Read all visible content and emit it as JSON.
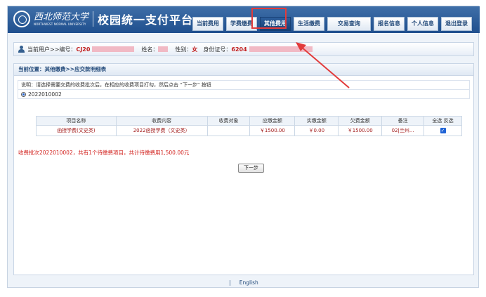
{
  "header": {
    "univ_cn": "西北师范大学",
    "univ_en": "NORTHWEST NORMAL UNIVERSITY",
    "platform_title": "校园统一支付平台"
  },
  "nav": [
    {
      "label": "当前费用",
      "active": false
    },
    {
      "label": "学费缴费",
      "active": false
    },
    {
      "label": "其他费用",
      "active": true
    },
    {
      "label": "生活缴费",
      "active": false
    },
    {
      "label": "交易查询",
      "active": false
    },
    {
      "label": "报名信息",
      "active": false
    },
    {
      "label": "个人信息",
      "active": false
    },
    {
      "label": "退出登录",
      "active": false
    }
  ],
  "userbar": {
    "current_user_label": "当前用户>>编号：",
    "user_id": "CJ20",
    "name_label": "姓名：",
    "gender_label": "性别：",
    "gender": "女",
    "id_label": "身份证号：",
    "id_number": "6204"
  },
  "breadcrumb": "当前位置：其他缴费>>应交款明细表",
  "note": "说明：请选择需要交费的收费批次后，在相应的收费项目打勾，然后点击 “下一步” 按钮",
  "batch": "2022010002",
  "table": {
    "headers": [
      "项目名称",
      "收费内容",
      "收费对象",
      "应缴金额",
      "实缴金额",
      "欠费金额",
      "备注",
      "全选 反选"
    ],
    "rows": [
      [
        "函授学费(文史类)",
        "2022函授学费（文史类）",
        "",
        "￥1500.00",
        "￥0.00",
        "￥1500.00",
        "02|兰州..."
      ]
    ]
  },
  "summary": "收费批次2022010002，共有1个待缴费项目，共计待缴费用1,500.00元",
  "next_button": "下一步",
  "footer": {
    "separator": "|",
    "language": "English"
  },
  "colors": {
    "header": "#2b5b97",
    "highlight": "#e23b3b",
    "text_red": "#c21f1f"
  }
}
